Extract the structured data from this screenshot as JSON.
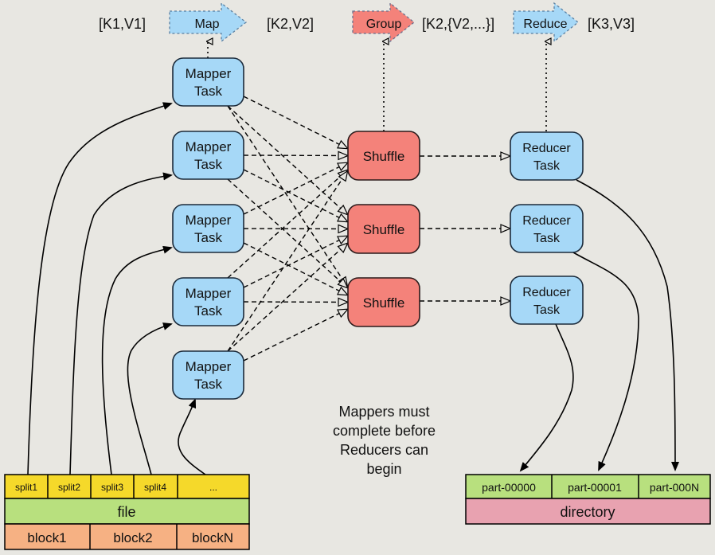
{
  "stages": {
    "k1v1": "[K1,V1]",
    "map": "Map",
    "k2v2": "[K2,V2]",
    "group": "Group",
    "k2list": "[K2,{V2,...}]",
    "reduce": "Reduce",
    "k3v3": "[K3,V3]"
  },
  "mappers": [
    {
      "line1": "Mapper",
      "line2": "Task"
    },
    {
      "line1": "Mapper",
      "line2": "Task"
    },
    {
      "line1": "Mapper",
      "line2": "Task"
    },
    {
      "line1": "Mapper",
      "line2": "Task"
    },
    {
      "line1": "Mapper",
      "line2": "Task"
    }
  ],
  "shuffles": [
    "Shuffle",
    "Shuffle",
    "Shuffle"
  ],
  "reducers": [
    {
      "line1": "Reducer",
      "line2": "Task"
    },
    {
      "line1": "Reducer",
      "line2": "Task"
    },
    {
      "line1": "Reducer",
      "line2": "Task"
    }
  ],
  "input": {
    "splits": [
      "split1",
      "split2",
      "split3",
      "split4",
      "..."
    ],
    "file": "file",
    "blocks": [
      "block1",
      "block2",
      "blockN"
    ]
  },
  "output": {
    "parts": [
      "part-00000",
      "part-00001",
      "part-000N"
    ],
    "directory": "directory"
  },
  "note": [
    "Mappers must",
    "complete before",
    "Reducers can",
    "begin"
  ],
  "colors": {
    "background": "#e8e7e2",
    "task_blue": "#a6d8f7",
    "shuffle_red": "#f4827a",
    "split_yellow": "#f5d92a",
    "file_green": "#b8e07e",
    "block_orange": "#f6b183",
    "directory_pink": "#e8a2b0"
  }
}
